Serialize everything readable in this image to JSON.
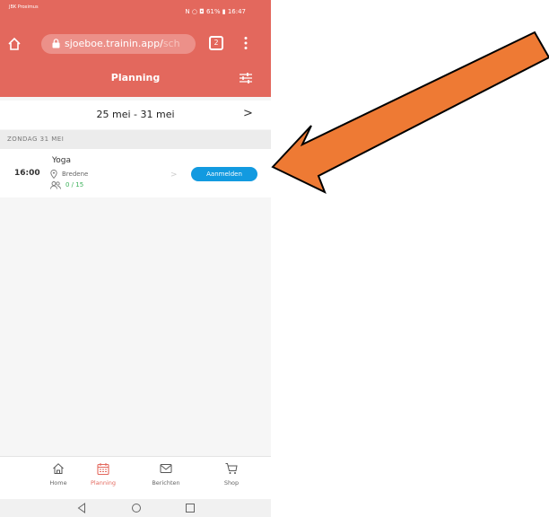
{
  "statusbar": {
    "carrier": "JBK Proximus",
    "signal": "·∥ ∥ı",
    "right": "N ○ ◘ 61% ▮ 16:47"
  },
  "browser": {
    "url_main": "sjoeboe.trainin.app/",
    "url_faded": "sch",
    "tab_count": "2"
  },
  "appbar": {
    "title": "Planning"
  },
  "week": {
    "label": "25 mei - 31 mei",
    "next": ">"
  },
  "day": {
    "label": "ZONDAG 31 MEI"
  },
  "event": {
    "time": "16:00",
    "title": "Yoga",
    "location": "Bredene",
    "capacity": "0 / 15",
    "button": "Aanmelden",
    "chevron": ">"
  },
  "nav": {
    "items": [
      {
        "label": "Home",
        "icon": "home-icon"
      },
      {
        "label": "Planning",
        "icon": "calendar-icon"
      },
      {
        "label": "Berichten",
        "icon": "mail-icon"
      },
      {
        "label": "Shop",
        "icon": "cart-icon"
      }
    ]
  },
  "colors": {
    "brand": "#e3685d",
    "button": "#129ae0",
    "arrow": "#ee7a34",
    "count": "#3cb15a"
  }
}
